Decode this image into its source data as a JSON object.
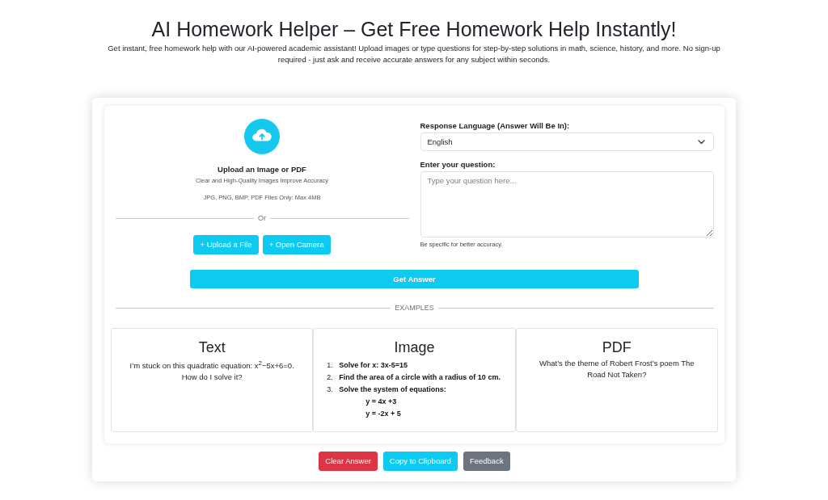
{
  "header": {
    "title": "AI Homework Helper – Get Free Homework Help Instantly!",
    "subtitle": "Get instant, free homework help with our AI-powered academic assistant! Upload images or type questions for step-by-step solutions in math, science, history, and more. No sign-up required - just ask and receive accurate answers for any subject within seconds."
  },
  "upload": {
    "title": "Upload an Image or PDF",
    "hint": "Clear and High-Quality Images Improve Accuracy",
    "formats": "JPG, PNG, BMP, PDF Files Only: Max 4MB",
    "divider": "Or",
    "buttons": [
      "+ Upload a File",
      "+ Open Camera"
    ]
  },
  "language": {
    "label": "Response Language (Answer Will Be In):",
    "value": "English"
  },
  "question": {
    "label": "Enter your question:",
    "placeholder": "Type your question here...",
    "hint": "Be specific for better accuracy."
  },
  "submit_button": "Get Answer",
  "examples": {
    "heading": "EXAMPLES",
    "cards": [
      {
        "kind": "paragraph",
        "title": "Text",
        "body": "I’m stuck on this quadratic equation: x$^{2}$−5x+6=0. How do I solve it?"
      },
      {
        "kind": "list",
        "title": "Image",
        "items": [
          {
            "number": "1.",
            "text": "Solve for x: 3x-5=15"
          },
          {
            "number": "2.",
            "text": "Find the area of a circle with a radius of 10 cm."
          },
          {
            "number": "3.",
            "text": "Solve the system of equations:",
            "lines": [
              "y = 4x +3",
              "y = -2x + 5"
            ]
          }
        ]
      },
      {
        "kind": "paragraph",
        "title": "PDF",
        "body": "What’s the theme of Robert Frost’s poem The Road Not Taken?"
      }
    ]
  },
  "actions": [
    {
      "label": "Clear Answer",
      "color": "#dc3545"
    },
    {
      "label": "Copy to Clipboard",
      "color": "#0dcaf0"
    },
    {
      "label": "Feedback",
      "color": "#6c757d"
    }
  ]
}
